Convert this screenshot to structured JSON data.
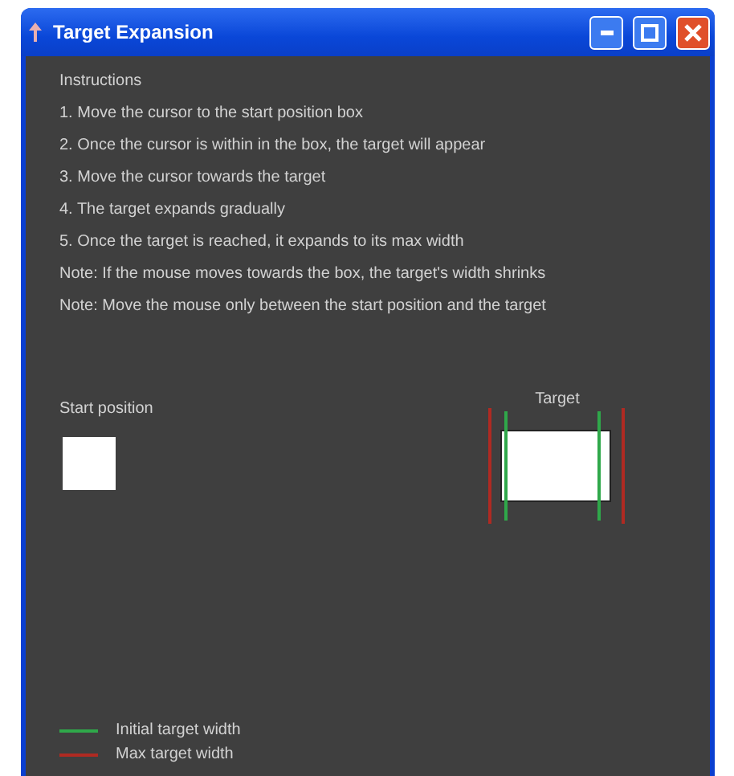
{
  "window": {
    "title": "Target Expansion"
  },
  "instructions": {
    "heading": "Instructions",
    "lines": [
      "1. Move the cursor to the start position box",
      "2. Once the cursor is within in the box, the target will appear",
      "3. Move the cursor towards the target",
      "4. The target expands gradually",
      "5. Once the target is reached, it expands to its max width",
      "Note: If the mouse moves towards the box, the target's width shrinks",
      "Note: Move the mouse only between the start position and the target"
    ]
  },
  "start": {
    "label": "Start position"
  },
  "target": {
    "label": "Target"
  },
  "legend": [
    {
      "kind": "initial",
      "label": "Initial target width",
      "color": "#2fa84a"
    },
    {
      "kind": "max",
      "label": "Max target width",
      "color": "#b02a22"
    }
  ]
}
